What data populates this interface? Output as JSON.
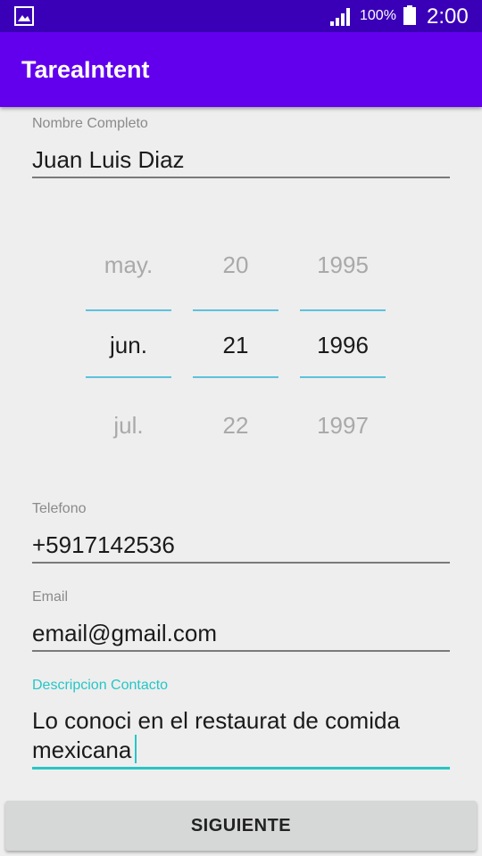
{
  "status_bar": {
    "battery_percent": "100%",
    "time": "2:00",
    "icons": [
      "gallery-icon",
      "signal-icon",
      "battery-icon"
    ]
  },
  "app_bar": {
    "title": "TareaIntent",
    "color": "#6200ee"
  },
  "form": {
    "nombre": {
      "label": "Nombre Completo",
      "value": "Juan Luis Diaz"
    },
    "date_picker": {
      "month": {
        "prev": "may.",
        "selected": "jun.",
        "next": "jul."
      },
      "day": {
        "prev": "20",
        "selected": "21",
        "next": "22"
      },
      "year": {
        "prev": "1995",
        "selected": "1996",
        "next": "1997"
      }
    },
    "telefono": {
      "label": "Telefono",
      "value": "+5917142536"
    },
    "email": {
      "label": "Email",
      "value": "email@gmail.com"
    },
    "descripcion": {
      "label": "Descripcion Contacto",
      "value": "Lo conoci en el restaurat  de comida mexicana",
      "focused": true
    }
  },
  "actions": {
    "next_label": "SIGUIENTE"
  },
  "colors": {
    "status_bar": "#3a00b8",
    "app_bar": "#6200ee",
    "accent": "#26c6c6",
    "picker_divider": "#5cc2dd",
    "background": "#eeeeee"
  }
}
